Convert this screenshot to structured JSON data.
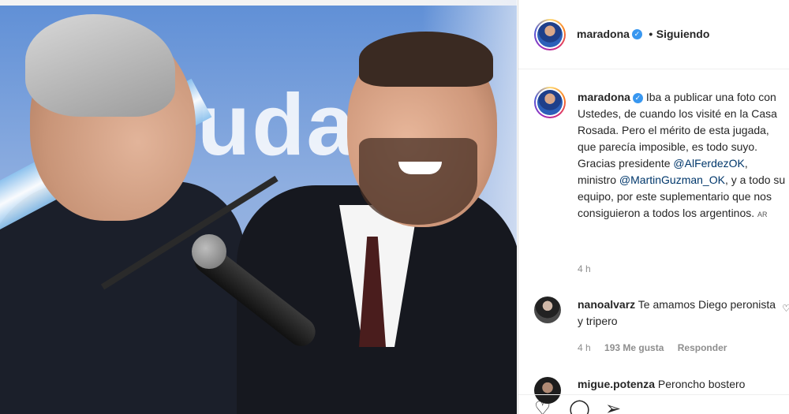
{
  "post": {
    "username": "maradona",
    "following_label": "Siguiendo",
    "caption_parts": {
      "text1": "Iba a publicar una foto con Ustedes, de cuando los visité en la Casa Rosada. Pero el mérito de esta jugada, que parecía imposible, es todo suyo. Gracias presidente",
      "mention1": "@AlFerdezOK",
      "text2": ", ministro",
      "mention2": "@MartinGuzman_OK",
      "text3": ", y a todo su equipo, por este suplementario que nos consiguieron a todos los argentinos.",
      "flag": "AR"
    },
    "caption_time": "4 h",
    "photo_text": "uda"
  },
  "comments": [
    {
      "username": "nanoalvarz",
      "text": "Te amamos Diego peronista y tripero",
      "time": "4 h",
      "likes": "193 Me gusta",
      "reply": "Responder"
    },
    {
      "username": "migue.potenza",
      "text": "Peroncho bostero"
    }
  ],
  "icons": {
    "like": "heart-icon",
    "comment": "comment-icon",
    "share": "share-icon",
    "verified": "verified-badge-icon"
  },
  "colors": {
    "link": "#00376b",
    "verified": "#3897f0"
  }
}
